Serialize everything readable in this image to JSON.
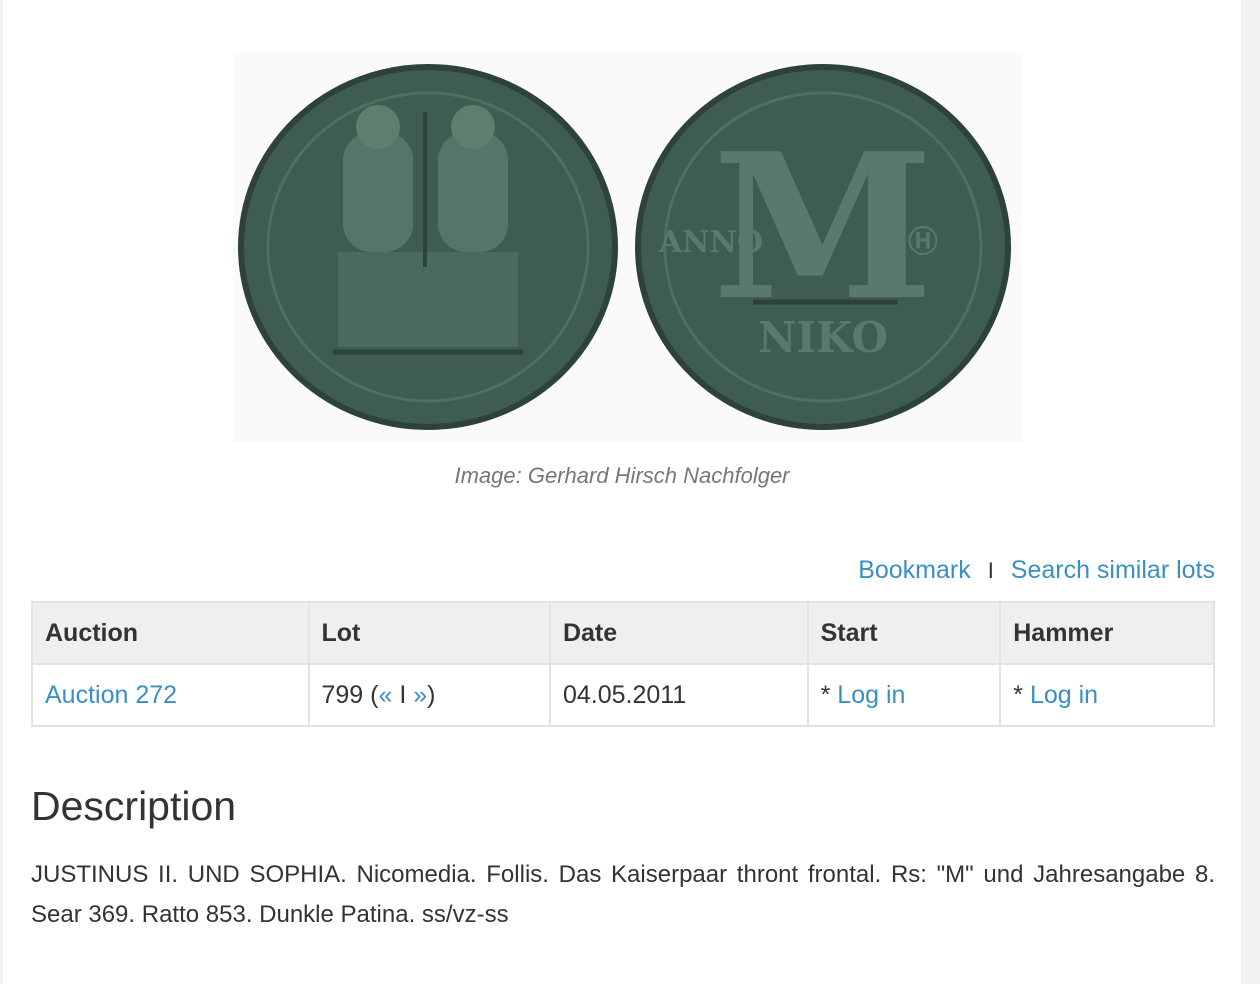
{
  "image_caption": "Image: Gerhard Hirsch Nachfolger",
  "actions": {
    "bookmark": "Bookmark",
    "separator": "I",
    "search_similar": "Search similar lots"
  },
  "table": {
    "headers": [
      "Auction",
      "Lot",
      "Date",
      "Start",
      "Hammer"
    ],
    "row": {
      "auction": "Auction 272",
      "lot_number": "799",
      "lot_open": "(",
      "prev": "«",
      "nav_sep": "I",
      "next": "»",
      "lot_close": ")",
      "date": "04.05.2011",
      "start_prefix": "*",
      "start_link": "Log in",
      "hammer_prefix": "*",
      "hammer_link": "Log in"
    }
  },
  "description": {
    "heading": "Description",
    "text": "JUSTINUS II. UND SOPHIA. Nicomedia. Follis. Das Kaiserpaar thront frontal. Rs: \"M\" und Jahresangabe 8. Sear 369. Ratto 853. Dunkle Patina. ss/vz-ss"
  },
  "colors": {
    "link": "#3a8fc6",
    "coin": "#3d5a4f",
    "header_bg": "#efefef"
  }
}
